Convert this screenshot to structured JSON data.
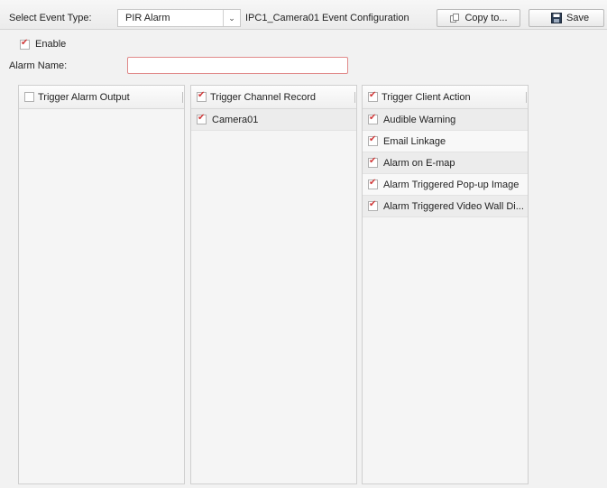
{
  "toolbar": {
    "select_label": "Select Event Type:",
    "event_type": "PIR Alarm",
    "config_title": "IPC1_Camera01 Event Configuration",
    "copy_label": "Copy to...",
    "save_label": "Save"
  },
  "enable": {
    "label": "Enable",
    "checked": true
  },
  "alarm_name": {
    "label": "Alarm Name:",
    "value": ""
  },
  "panels": {
    "alarm_output": {
      "header": "Trigger Alarm Output",
      "checked": false
    },
    "channel_record": {
      "header": "Trigger Channel Record",
      "checked": true,
      "rows": [
        {
          "label": "Camera01",
          "checked": true
        }
      ]
    },
    "client_action": {
      "header": "Trigger Client Action",
      "checked": true,
      "rows": [
        {
          "label": "Audible Warning",
          "checked": true
        },
        {
          "label": "Email Linkage",
          "checked": true
        },
        {
          "label": "Alarm on E-map",
          "checked": true
        },
        {
          "label": "Alarm Triggered Pop-up Image",
          "checked": true
        },
        {
          "label": "Alarm Triggered Video Wall Di...",
          "checked": true
        }
      ]
    }
  },
  "colors": {
    "check": "#d13a3a",
    "input_border": "#e08a8a"
  }
}
